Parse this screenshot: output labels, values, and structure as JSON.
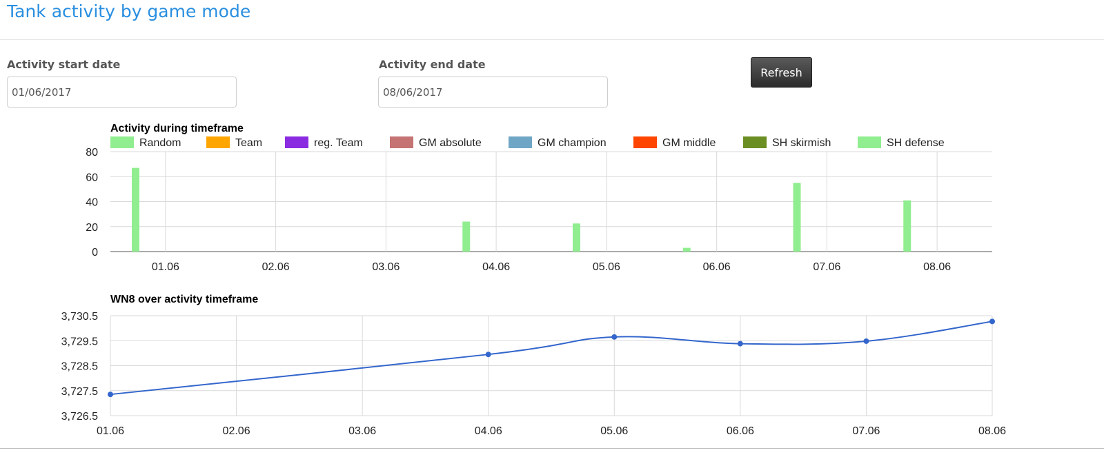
{
  "page": {
    "title": "Tank activity by game mode"
  },
  "filters": {
    "start_label": "Activity start date",
    "start_value": "01/06/2017",
    "end_label": "Activity end date",
    "end_value": "08/06/2017",
    "refresh_label": "Refresh"
  },
  "chart_data": [
    {
      "type": "bar",
      "title": "Activity during timeframe",
      "categories": [
        "01.06",
        "02.06",
        "03.06",
        "04.06",
        "05.06",
        "06.06",
        "07.06",
        "08.06"
      ],
      "ylim": [
        0,
        80
      ],
      "yticks": [
        0,
        20,
        40,
        60,
        80
      ],
      "grid": true,
      "legend_position": "top",
      "series": [
        {
          "name": "Random",
          "color": "#90ee90",
          "values": [
            67,
            0,
            0,
            24,
            22.5,
            3,
            55,
            41
          ]
        },
        {
          "name": "Team",
          "color": "#ffa500",
          "values": [
            0,
            0,
            0,
            0,
            0,
            0,
            0,
            0
          ]
        },
        {
          "name": "reg. Team",
          "color": "#8a2be2",
          "values": [
            0,
            0,
            0,
            0,
            0,
            0,
            0,
            0
          ]
        },
        {
          "name": "GM absolute",
          "color": "#c57373",
          "values": [
            0,
            0,
            0,
            0,
            0,
            0,
            0,
            0
          ]
        },
        {
          "name": "GM champion",
          "color": "#6fa6c6",
          "values": [
            0,
            0,
            0,
            0,
            0,
            0,
            0,
            0
          ]
        },
        {
          "name": "GM middle",
          "color": "#ff4500",
          "values": [
            0,
            0,
            0,
            0,
            0,
            0,
            0,
            0
          ]
        },
        {
          "name": "SH skirmish",
          "color": "#6b8e23",
          "values": [
            0,
            0,
            0,
            0,
            0,
            0,
            0,
            0
          ]
        },
        {
          "name": "SH defense",
          "color": "#90ee90",
          "values": [
            0,
            0,
            0,
            0,
            0,
            0,
            0,
            0
          ]
        }
      ]
    },
    {
      "type": "line",
      "title": "WN8 over activity timeframe",
      "x": [
        "01.06",
        "02.06",
        "03.06",
        "04.06",
        "05.06",
        "06.06",
        "07.06",
        "08.06"
      ],
      "ylim": [
        3726.5,
        3730.5
      ],
      "yticks": [
        "3,726.5",
        "3,727.5",
        "3,728.5",
        "3,729.5",
        "3,730.5"
      ],
      "grid": true,
      "color": "#3366cc",
      "points": [
        {
          "x": "01.06",
          "y": 3727.35
        },
        {
          "x": "04.06",
          "y": 3728.95
        },
        {
          "x": "05.06",
          "y": 3729.65
        },
        {
          "x": "06.06",
          "y": 3729.38
        },
        {
          "x": "07.06",
          "y": 3729.48
        },
        {
          "x": "08.06",
          "y": 3730.27
        }
      ]
    }
  ]
}
